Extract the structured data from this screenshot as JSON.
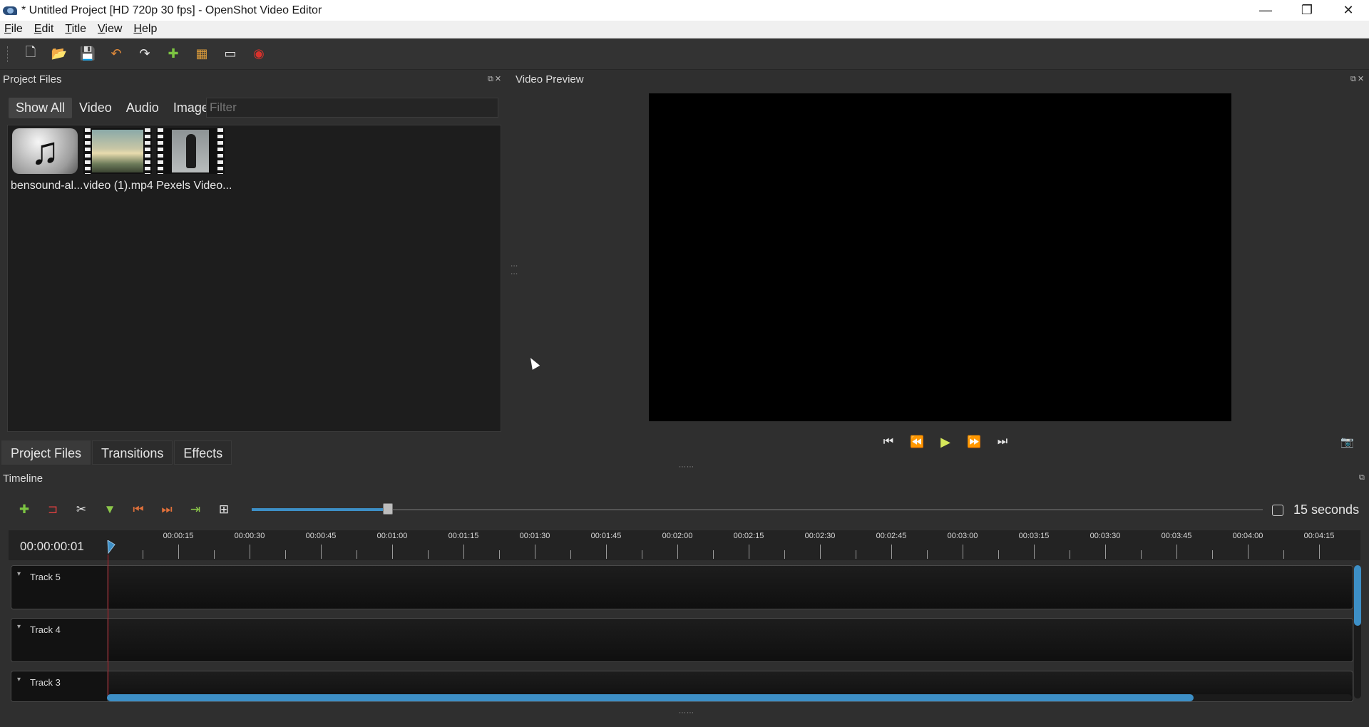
{
  "window": {
    "title": "* Untitled Project [HD 720p 30 fps] - OpenShot Video Editor",
    "minimize": "—",
    "maximize": "❐",
    "close": "✕"
  },
  "menu": [
    "File",
    "Edit",
    "Title",
    "View",
    "Help"
  ],
  "toolbar": [
    {
      "name": "new-project",
      "glyph": "🗋",
      "color": "#e8e8e8"
    },
    {
      "name": "open-project",
      "glyph": "📂",
      "color": "#e0c060"
    },
    {
      "name": "save-project",
      "glyph": "💾",
      "color": "#c0b070"
    },
    {
      "name": "undo",
      "glyph": "↶",
      "color": "#e08a3a"
    },
    {
      "name": "redo",
      "glyph": "↷",
      "color": "#e8e8e8"
    },
    {
      "name": "import-files",
      "glyph": "✚",
      "color": "#7cc442"
    },
    {
      "name": "profile",
      "glyph": "▦",
      "color": "#d99a3a"
    },
    {
      "name": "fullscreen",
      "glyph": "▭",
      "color": "#e8e8e8"
    },
    {
      "name": "export-video",
      "glyph": "◉",
      "color": "#d8322c"
    }
  ],
  "project_files": {
    "title": "Project Files",
    "filters": [
      "Show All",
      "Video",
      "Audio",
      "Image"
    ],
    "active_filter": "Show All",
    "filter_placeholder": "Filter",
    "files": [
      {
        "label": "bensound-al...",
        "type": "audio"
      },
      {
        "label": "video (1).mp4",
        "type": "video"
      },
      {
        "label": "Pexels Video...",
        "type": "video"
      }
    ]
  },
  "bottom_tabs": [
    "Project Files",
    "Transitions",
    "Effects"
  ],
  "video_preview": {
    "title": "Video Preview",
    "controls": [
      "⏮",
      "⏪",
      "▶",
      "⏩",
      "⏭"
    ],
    "camera_icon": "📷"
  },
  "timeline": {
    "title": "Timeline",
    "tools": [
      {
        "name": "add-track",
        "glyph": "✚",
        "color": "#7cc442"
      },
      {
        "name": "snapping",
        "glyph": "⊐",
        "color": "#e04040"
      },
      {
        "name": "razor",
        "glyph": "✂",
        "color": "#e8e8e8"
      },
      {
        "name": "add-marker",
        "glyph": "▼",
        "color": "#8cc84a"
      },
      {
        "name": "previous-marker",
        "glyph": "⏮",
        "color": "#e0703a"
      },
      {
        "name": "next-marker",
        "glyph": "⏭",
        "color": "#e0703a"
      },
      {
        "name": "center-playhead",
        "glyph": "⇥",
        "color": "#8cc84a"
      },
      {
        "name": "zoom-fit",
        "glyph": "⊞",
        "color": "#e8e8e8"
      }
    ],
    "zoom": 0.135,
    "zoom_label": "15 seconds",
    "timecode": "00:00:00:01",
    "ruler_labels": [
      "00:00:15",
      "00:00:30",
      "00:00:45",
      "00:01:00",
      "00:01:15",
      "00:01:30",
      "00:01:45",
      "00:02:00",
      "00:02:15",
      "00:02:30",
      "00:02:45",
      "00:03:00",
      "00:03:15",
      "00:03:30",
      "00:03:45",
      "00:04:00",
      "00:04:15"
    ],
    "tracks": [
      "Track 5",
      "Track 4",
      "Track 3"
    ]
  }
}
